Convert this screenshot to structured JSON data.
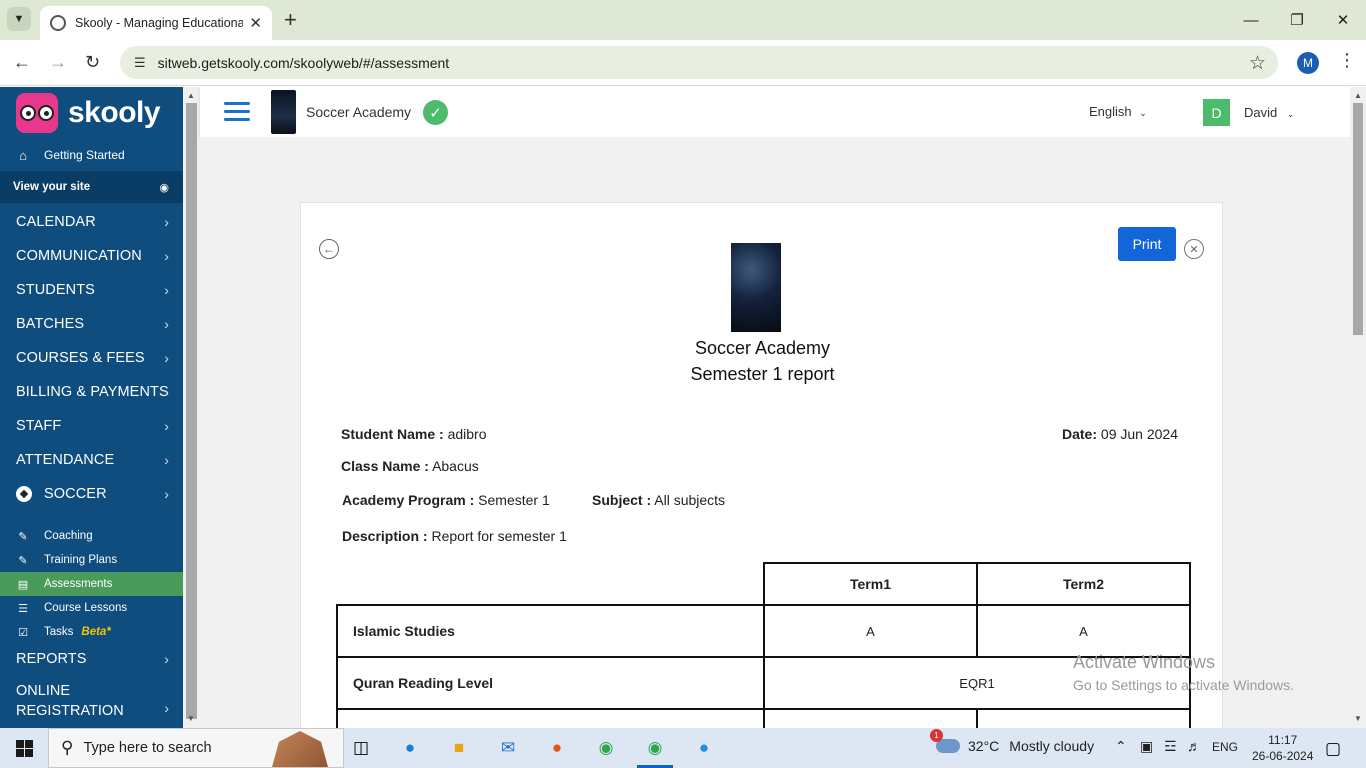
{
  "browser": {
    "tab_title": "Skooly - Managing Educational",
    "url": "sitweb.getskooly.com/skoolyweb/#/assessment",
    "profile_initial": "M"
  },
  "sidebar": {
    "logo_text": "skooly",
    "getting_started": "Getting Started",
    "view_site": "View your site",
    "menu": [
      {
        "label": "CALENDAR"
      },
      {
        "label": "COMMUNICATION"
      },
      {
        "label": "STUDENTS"
      },
      {
        "label": "BATCHES"
      },
      {
        "label": "COURSES & FEES"
      },
      {
        "label": "BILLING & PAYMENTS"
      },
      {
        "label": "STAFF"
      },
      {
        "label": "ATTENDANCE"
      },
      {
        "label": "SOCCER"
      }
    ],
    "submenu": [
      {
        "label": "Coaching"
      },
      {
        "label": "Training Plans"
      },
      {
        "label": "Assessments"
      },
      {
        "label": "Course Lessons"
      },
      {
        "label": "Tasks"
      }
    ],
    "beta_label": "Beta*",
    "reports": "REPORTS",
    "online_registration_1": "ONLINE",
    "online_registration_2": "REGISTRATION"
  },
  "header": {
    "academy_name": "Soccer Academy",
    "language": "English",
    "user_initial": "D",
    "user_name": "David"
  },
  "report": {
    "print_label": "Print",
    "academy_name": "Soccer Academy",
    "report_title": "Semester 1 report",
    "student_name_label": "Student Name :",
    "student_name": "adibro",
    "date_label": "Date:",
    "date": "09 Jun 2024",
    "class_name_label": "Class Name :",
    "class_name": "Abacus",
    "program_label": "Academy Program :",
    "program": "Semester 1",
    "subject_label": "Subject :",
    "subject": "All subjects",
    "description_label": "Description :",
    "description": "Report for semester 1",
    "terms": [
      "Term1",
      "Term2"
    ],
    "rows": [
      {
        "subject": "Islamic Studies",
        "term1": "A",
        "term2": "A"
      },
      {
        "subject": "Quran Reading Level",
        "combined": "EQR1"
      }
    ]
  },
  "watermark": {
    "line1": "Activate Windows",
    "line2": "Go to Settings to activate Windows."
  },
  "taskbar": {
    "search_placeholder": "Type here to search",
    "weather_badge": "1",
    "temperature": "32°C",
    "weather": "Mostly cloudy",
    "language": "ENG",
    "time": "11:17",
    "date": "26-06-2024"
  }
}
